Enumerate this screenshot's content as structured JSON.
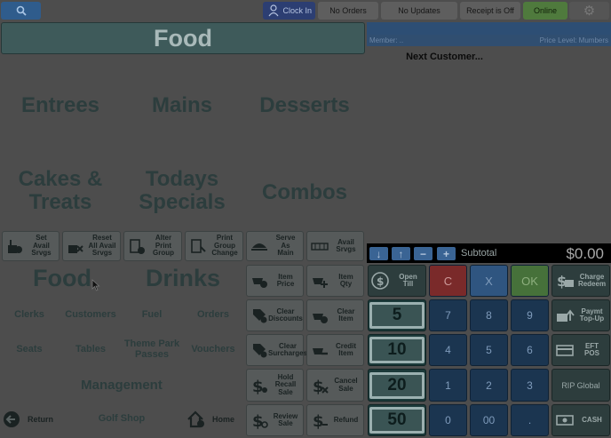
{
  "topbar": {
    "search_icon": "magnifier-icon",
    "clock_in": "Clock In",
    "no_orders": "No Orders",
    "no_updates": "No Updates",
    "receipt": "Receipt is Off",
    "online": "Online",
    "settings_icon": "gear-icon"
  },
  "page_title": "Food",
  "member": {
    "member_label": "Member: ..",
    "price_level": "Price Level: Mumbers"
  },
  "next_customer": "Next Customer...",
  "categories": {
    "entrees": "Entrees",
    "mains": "Mains",
    "desserts": "Desserts",
    "cakes_1": "Cakes &",
    "cakes_2": "Treats",
    "todays_1": "Todays",
    "todays_2": "Specials",
    "combos": "Combos",
    "food": "Food",
    "drinks": "Drinks"
  },
  "nav": {
    "clerks": "Clerks",
    "customers": "Customers",
    "fuel": "Fuel",
    "orders": "Orders",
    "seats": "Seats",
    "tables": "Tables",
    "theme_park_1": "Theme Park",
    "theme_park_2": "Passes",
    "vouchers": "Vouchers",
    "management": "Management",
    "return": "Return",
    "golf_shop": "Golf Shop",
    "home": "Home"
  },
  "tools": {
    "set_avail": [
      "Set",
      "Avail",
      "Srvgs"
    ],
    "reset_avail": [
      "Reset",
      "All Avail",
      "Srvgs"
    ],
    "alter_print": [
      "Alter",
      "Print",
      "Group"
    ],
    "print_group_change": [
      "Print",
      "Group",
      "Change"
    ],
    "serve_as_main": [
      "Serve",
      "As",
      "Main"
    ],
    "avail_srvgs": [
      "Avail",
      "Srvgs"
    ],
    "item_price": [
      "Item",
      "Price"
    ],
    "item_qty": [
      "Item",
      "Qty"
    ],
    "clear_discounts": [
      "Clear",
      "Discounts"
    ],
    "clear_item": [
      "Clear",
      "Item"
    ],
    "clear_surcharges": [
      "Clear",
      "Surcharges"
    ],
    "credit_item": [
      "Credit",
      "Item"
    ],
    "hold_recall_sale": [
      "Hold",
      "Recall",
      "Sale"
    ],
    "cancel_sale": [
      "Cancel",
      "Sale"
    ],
    "review_sale": [
      "Review",
      "Sale"
    ],
    "refund": "Refund"
  },
  "subtotal": {
    "label": "Subtotal",
    "value": "$0.00"
  },
  "keypad": {
    "open_till": [
      "Open",
      "Till"
    ],
    "c": "C",
    "x": "X",
    "ok": "OK",
    "charge_redeem": [
      "Charge",
      "Redeem"
    ],
    "n5": "5",
    "n10": "10",
    "n20": "20",
    "n50": "50",
    "k7": "7",
    "k8": "8",
    "k9": "9",
    "k4": "4",
    "k5": "5",
    "k6": "6",
    "k1": "1",
    "k2": "2",
    "k3": "3",
    "k0": "0",
    "k00": "00",
    "kdot": ".",
    "paymt_topup": [
      "Paymt",
      "Top-Up"
    ],
    "eft_pos": [
      "EFT",
      "POS"
    ],
    "rip_global": "RIP Global",
    "cash": "CASH"
  },
  "colors": {
    "clear_red": "#8b2e2e",
    "ok_green": "#4f7a3d",
    "key_blue": "#1e4d84"
  }
}
